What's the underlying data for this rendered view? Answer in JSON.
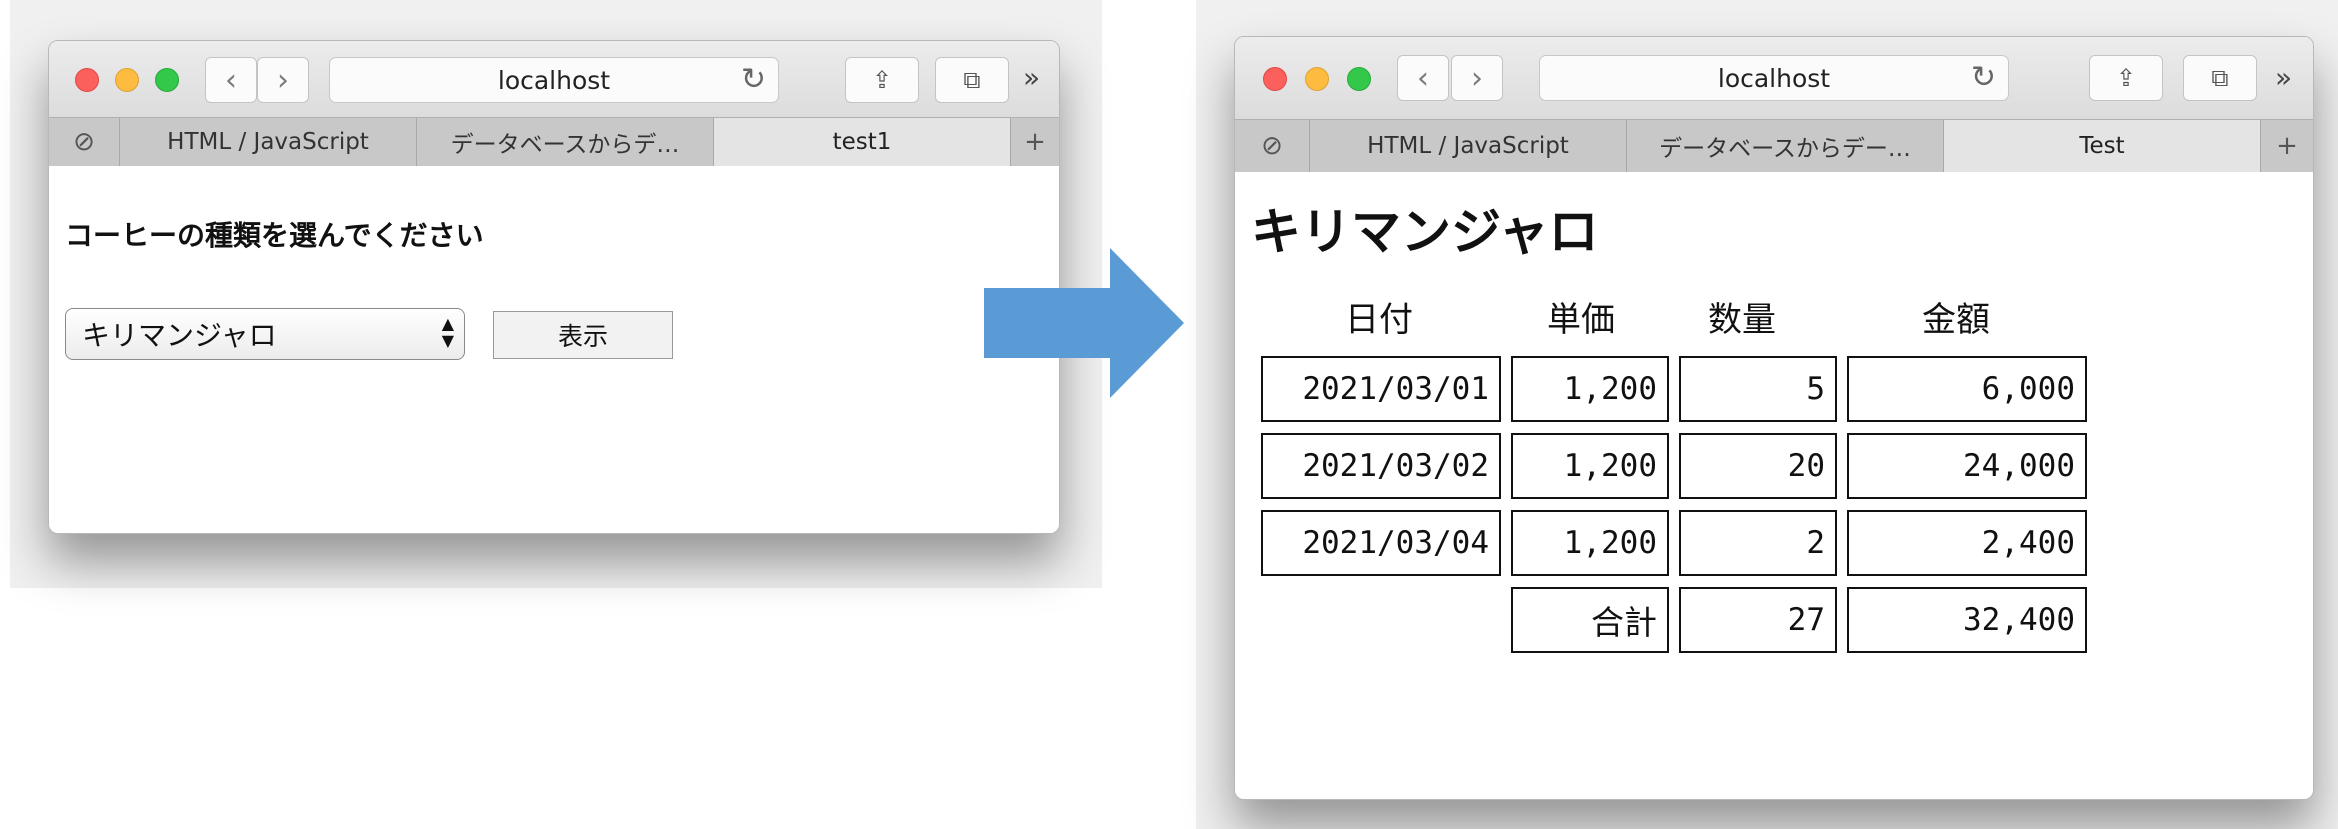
{
  "left_window": {
    "address": "localhost",
    "tabs": [
      {
        "icon": "compass-icon"
      },
      {
        "label": "HTML / JavaScript"
      },
      {
        "label": "データベースからデ…"
      },
      {
        "label": "test1"
      }
    ],
    "heading": "コーヒーの種類を選んでください",
    "select_value": "キリマンジャロ",
    "show_button": "表示"
  },
  "right_window": {
    "address": "localhost",
    "tabs": [
      {
        "icon": "compass-icon"
      },
      {
        "label": "HTML / JavaScript"
      },
      {
        "label": "データベースからデー…"
      },
      {
        "label": "Test"
      }
    ],
    "heading": "キリマンジャロ",
    "table": {
      "headers": [
        "日付",
        "単価",
        "数量",
        "金額"
      ],
      "rows": [
        [
          "2021/03/01",
          "1,200",
          "5",
          "6,000"
        ],
        [
          "2021/03/02",
          "1,200",
          "20",
          "24,000"
        ],
        [
          "2021/03/04",
          "1,200",
          "2",
          "2,400"
        ]
      ],
      "total": {
        "label": "合計",
        "quantity": "27",
        "amount": "32,400"
      }
    }
  },
  "colors": {
    "arrow": "#5b9bd5"
  }
}
